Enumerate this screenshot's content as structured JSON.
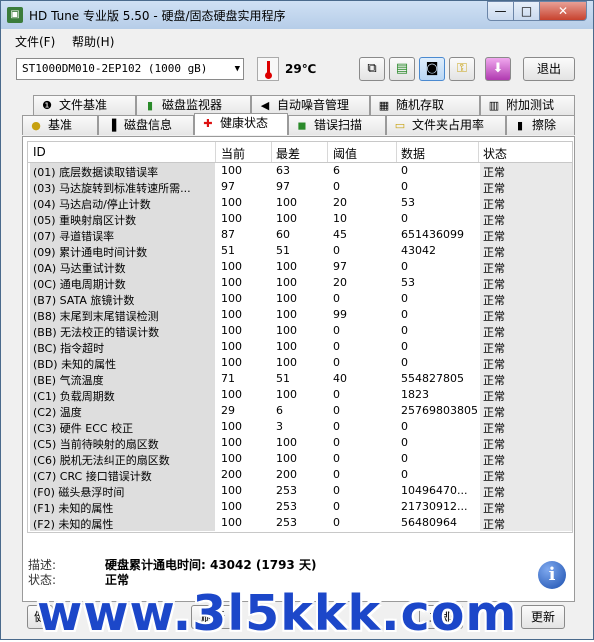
{
  "window": {
    "title": "HD Tune 专业版 5.50 - 硬盘/固态硬盘实用程序",
    "min": "—",
    "max": "□",
    "close": "✕"
  },
  "menu": {
    "file": "文件(F)",
    "help": "帮助(H)"
  },
  "toolbar": {
    "drive": "ST1000DM010-2EP102 (1000 gB)",
    "temperature": "29℃",
    "exit": "退出",
    "icons": [
      "copy-icon",
      "paste-icon",
      "camera-icon",
      "key-icon",
      "download-icon"
    ]
  },
  "tabs_top": [
    {
      "label": "文件基准",
      "icon": "file-benchmark-icon"
    },
    {
      "label": "磁盘监视器",
      "icon": "monitor-icon"
    },
    {
      "label": "自动噪音管理",
      "icon": "speaker-icon"
    },
    {
      "label": "随机存取",
      "icon": "random-access-icon"
    },
    {
      "label": "附加测试",
      "icon": "extra-tests-icon"
    }
  ],
  "tabs_bottom": [
    {
      "label": "基准",
      "icon": "benchmark-icon"
    },
    {
      "label": "磁盘信息",
      "icon": "info-icon"
    },
    {
      "label": "健康状态",
      "icon": "health-icon",
      "active": true
    },
    {
      "label": "错误扫描",
      "icon": "error-scan-icon"
    },
    {
      "label": "文件夹占用率",
      "icon": "folder-icon"
    },
    {
      "label": "擦除",
      "icon": "erase-icon"
    }
  ],
  "table": {
    "headers": [
      "ID",
      "当前",
      "最差",
      "阈值",
      "数据",
      "状态"
    ],
    "rows": [
      [
        "(01) 底层数据读取错误率",
        "100",
        "63",
        "6",
        "0",
        "正常"
      ],
      [
        "(03) 马达旋转到标准转速所需...",
        "97",
        "97",
        "0",
        "0",
        "正常"
      ],
      [
        "(04) 马达启动/停止计数",
        "100",
        "100",
        "20",
        "53",
        "正常"
      ],
      [
        "(05) 重映射扇区计数",
        "100",
        "100",
        "10",
        "0",
        "正常"
      ],
      [
        "(07) 寻道错误率",
        "87",
        "60",
        "45",
        "651436099",
        "正常"
      ],
      [
        "(09) 累计通电时间计数",
        "51",
        "51",
        "0",
        "43042",
        "正常"
      ],
      [
        "(0A) 马达重试计数",
        "100",
        "100",
        "97",
        "0",
        "正常"
      ],
      [
        "(0C) 通电周期计数",
        "100",
        "100",
        "20",
        "53",
        "正常"
      ],
      [
        "(B7) SATA 旅镜计数",
        "100",
        "100",
        "0",
        "0",
        "正常"
      ],
      [
        "(B8) 末尾到末尾错误检测",
        "100",
        "100",
        "99",
        "0",
        "正常"
      ],
      [
        "(BB) 无法校正的错误计数",
        "100",
        "100",
        "0",
        "0",
        "正常"
      ],
      [
        "(BC) 指令超时",
        "100",
        "100",
        "0",
        "0",
        "正常"
      ],
      [
        "(BD) 未知的属性",
        "100",
        "100",
        "0",
        "0",
        "正常"
      ],
      [
        "(BE) 气流温度",
        "71",
        "51",
        "40",
        "554827805",
        "正常"
      ],
      [
        "(C1) 负载周期数",
        "100",
        "100",
        "0",
        "1823",
        "正常"
      ],
      [
        "(C2) 温度",
        "29",
        "6",
        "0",
        "25769803805",
        "正常"
      ],
      [
        "(C3) 硬件 ECC 校正",
        "100",
        "3",
        "0",
        "0",
        "正常"
      ],
      [
        "(C5) 当前待映射的扇区数",
        "100",
        "100",
        "0",
        "0",
        "正常"
      ],
      [
        "(C6) 脱机无法纠正的扇区数",
        "100",
        "100",
        "0",
        "0",
        "正常"
      ],
      [
        "(C7) CRC 接口错误计数",
        "200",
        "200",
        "0",
        "0",
        "正常"
      ],
      [
        "(F0) 磁头悬浮时间",
        "100",
        "253",
        "0",
        "10496470...",
        "正常"
      ],
      [
        "(F1) 未知的属性",
        "100",
        "253",
        "0",
        "21730912...",
        "正常"
      ],
      [
        "(F2) 未知的属性",
        "100",
        "253",
        "0",
        "56480964",
        "正常"
      ]
    ]
  },
  "details": {
    "desc_label": "描述:",
    "desc_value": "硬盘累计通电时间: 43042 (1793 天)",
    "status_label": "状态:",
    "status_value": "正常"
  },
  "bottom": {
    "btn1": "健",
    "btn2": "刷新",
    "btn3": "立即",
    "btn4": "更新"
  },
  "watermark": "www.3l5kkk.com"
}
